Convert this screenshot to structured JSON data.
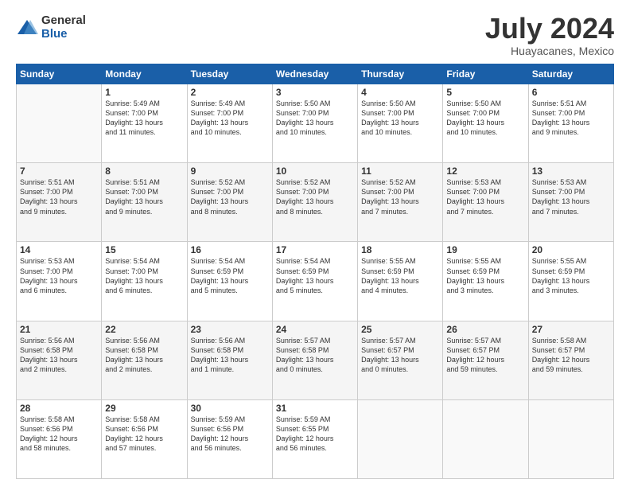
{
  "logo": {
    "general": "General",
    "blue": "Blue"
  },
  "title": "July 2024",
  "location": "Huayacanes, Mexico",
  "days_of_week": [
    "Sunday",
    "Monday",
    "Tuesday",
    "Wednesday",
    "Thursday",
    "Friday",
    "Saturday"
  ],
  "weeks": [
    [
      {
        "day": "",
        "info": ""
      },
      {
        "day": "1",
        "info": "Sunrise: 5:49 AM\nSunset: 7:00 PM\nDaylight: 13 hours\nand 11 minutes."
      },
      {
        "day": "2",
        "info": "Sunrise: 5:49 AM\nSunset: 7:00 PM\nDaylight: 13 hours\nand 10 minutes."
      },
      {
        "day": "3",
        "info": "Sunrise: 5:50 AM\nSunset: 7:00 PM\nDaylight: 13 hours\nand 10 minutes."
      },
      {
        "day": "4",
        "info": "Sunrise: 5:50 AM\nSunset: 7:00 PM\nDaylight: 13 hours\nand 10 minutes."
      },
      {
        "day": "5",
        "info": "Sunrise: 5:50 AM\nSunset: 7:00 PM\nDaylight: 13 hours\nand 10 minutes."
      },
      {
        "day": "6",
        "info": "Sunrise: 5:51 AM\nSunset: 7:00 PM\nDaylight: 13 hours\nand 9 minutes."
      }
    ],
    [
      {
        "day": "7",
        "info": "Sunrise: 5:51 AM\nSunset: 7:00 PM\nDaylight: 13 hours\nand 9 minutes."
      },
      {
        "day": "8",
        "info": "Sunrise: 5:51 AM\nSunset: 7:00 PM\nDaylight: 13 hours\nand 9 minutes."
      },
      {
        "day": "9",
        "info": "Sunrise: 5:52 AM\nSunset: 7:00 PM\nDaylight: 13 hours\nand 8 minutes."
      },
      {
        "day": "10",
        "info": "Sunrise: 5:52 AM\nSunset: 7:00 PM\nDaylight: 13 hours\nand 8 minutes."
      },
      {
        "day": "11",
        "info": "Sunrise: 5:52 AM\nSunset: 7:00 PM\nDaylight: 13 hours\nand 7 minutes."
      },
      {
        "day": "12",
        "info": "Sunrise: 5:53 AM\nSunset: 7:00 PM\nDaylight: 13 hours\nand 7 minutes."
      },
      {
        "day": "13",
        "info": "Sunrise: 5:53 AM\nSunset: 7:00 PM\nDaylight: 13 hours\nand 7 minutes."
      }
    ],
    [
      {
        "day": "14",
        "info": "Sunrise: 5:53 AM\nSunset: 7:00 PM\nDaylight: 13 hours\nand 6 minutes."
      },
      {
        "day": "15",
        "info": "Sunrise: 5:54 AM\nSunset: 7:00 PM\nDaylight: 13 hours\nand 6 minutes."
      },
      {
        "day": "16",
        "info": "Sunrise: 5:54 AM\nSunset: 6:59 PM\nDaylight: 13 hours\nand 5 minutes."
      },
      {
        "day": "17",
        "info": "Sunrise: 5:54 AM\nSunset: 6:59 PM\nDaylight: 13 hours\nand 5 minutes."
      },
      {
        "day": "18",
        "info": "Sunrise: 5:55 AM\nSunset: 6:59 PM\nDaylight: 13 hours\nand 4 minutes."
      },
      {
        "day": "19",
        "info": "Sunrise: 5:55 AM\nSunset: 6:59 PM\nDaylight: 13 hours\nand 3 minutes."
      },
      {
        "day": "20",
        "info": "Sunrise: 5:55 AM\nSunset: 6:59 PM\nDaylight: 13 hours\nand 3 minutes."
      }
    ],
    [
      {
        "day": "21",
        "info": "Sunrise: 5:56 AM\nSunset: 6:58 PM\nDaylight: 13 hours\nand 2 minutes."
      },
      {
        "day": "22",
        "info": "Sunrise: 5:56 AM\nSunset: 6:58 PM\nDaylight: 13 hours\nand 2 minutes."
      },
      {
        "day": "23",
        "info": "Sunrise: 5:56 AM\nSunset: 6:58 PM\nDaylight: 13 hours\nand 1 minute."
      },
      {
        "day": "24",
        "info": "Sunrise: 5:57 AM\nSunset: 6:58 PM\nDaylight: 13 hours\nand 0 minutes."
      },
      {
        "day": "25",
        "info": "Sunrise: 5:57 AM\nSunset: 6:57 PM\nDaylight: 13 hours\nand 0 minutes."
      },
      {
        "day": "26",
        "info": "Sunrise: 5:57 AM\nSunset: 6:57 PM\nDaylight: 12 hours\nand 59 minutes."
      },
      {
        "day": "27",
        "info": "Sunrise: 5:58 AM\nSunset: 6:57 PM\nDaylight: 12 hours\nand 59 minutes."
      }
    ],
    [
      {
        "day": "28",
        "info": "Sunrise: 5:58 AM\nSunset: 6:56 PM\nDaylight: 12 hours\nand 58 minutes."
      },
      {
        "day": "29",
        "info": "Sunrise: 5:58 AM\nSunset: 6:56 PM\nDaylight: 12 hours\nand 57 minutes."
      },
      {
        "day": "30",
        "info": "Sunrise: 5:59 AM\nSunset: 6:56 PM\nDaylight: 12 hours\nand 56 minutes."
      },
      {
        "day": "31",
        "info": "Sunrise: 5:59 AM\nSunset: 6:55 PM\nDaylight: 12 hours\nand 56 minutes."
      },
      {
        "day": "",
        "info": ""
      },
      {
        "day": "",
        "info": ""
      },
      {
        "day": "",
        "info": ""
      }
    ]
  ]
}
